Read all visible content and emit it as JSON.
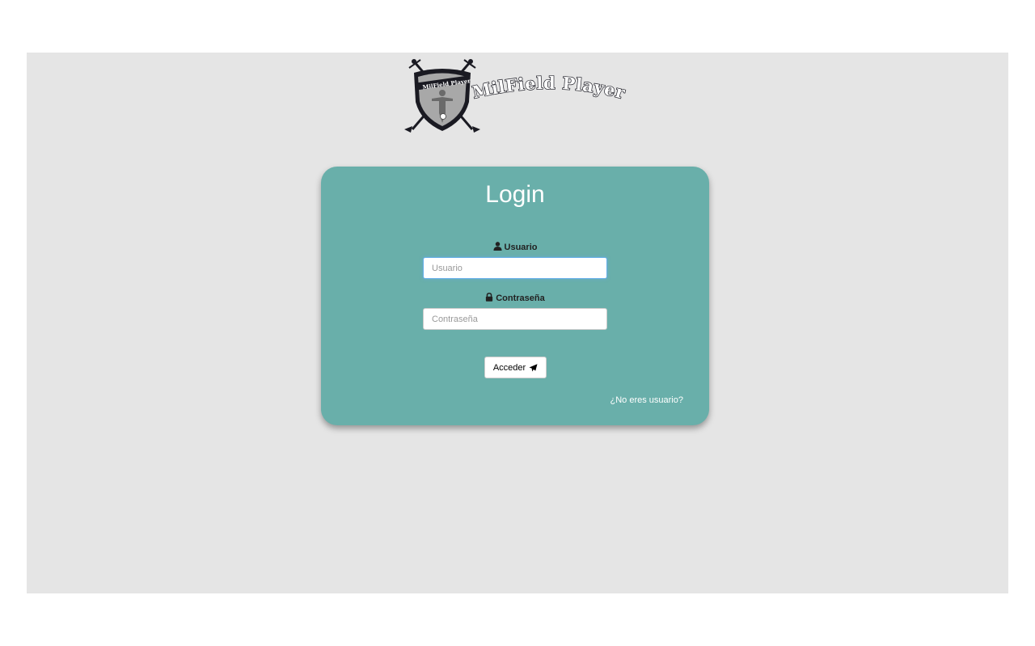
{
  "brand": {
    "logo_text": "MilField Player",
    "shield_text": "MilField Player"
  },
  "login": {
    "title": "Login",
    "username_label": "Usuario",
    "username_placeholder": "Usuario",
    "username_value": "",
    "password_label": "Contraseña",
    "password_placeholder": "Contraseña",
    "password_value": "",
    "submit_label": "Acceder",
    "signup_link": "¿No eres usuario?"
  },
  "icons": {
    "username": "user-icon",
    "password": "lock-icon",
    "submit": "send-icon"
  },
  "colors": {
    "page_background": "#e5e5e5",
    "card_background": "#69afaa",
    "title_color": "#ffffff",
    "focus_border": "#66afe9"
  }
}
